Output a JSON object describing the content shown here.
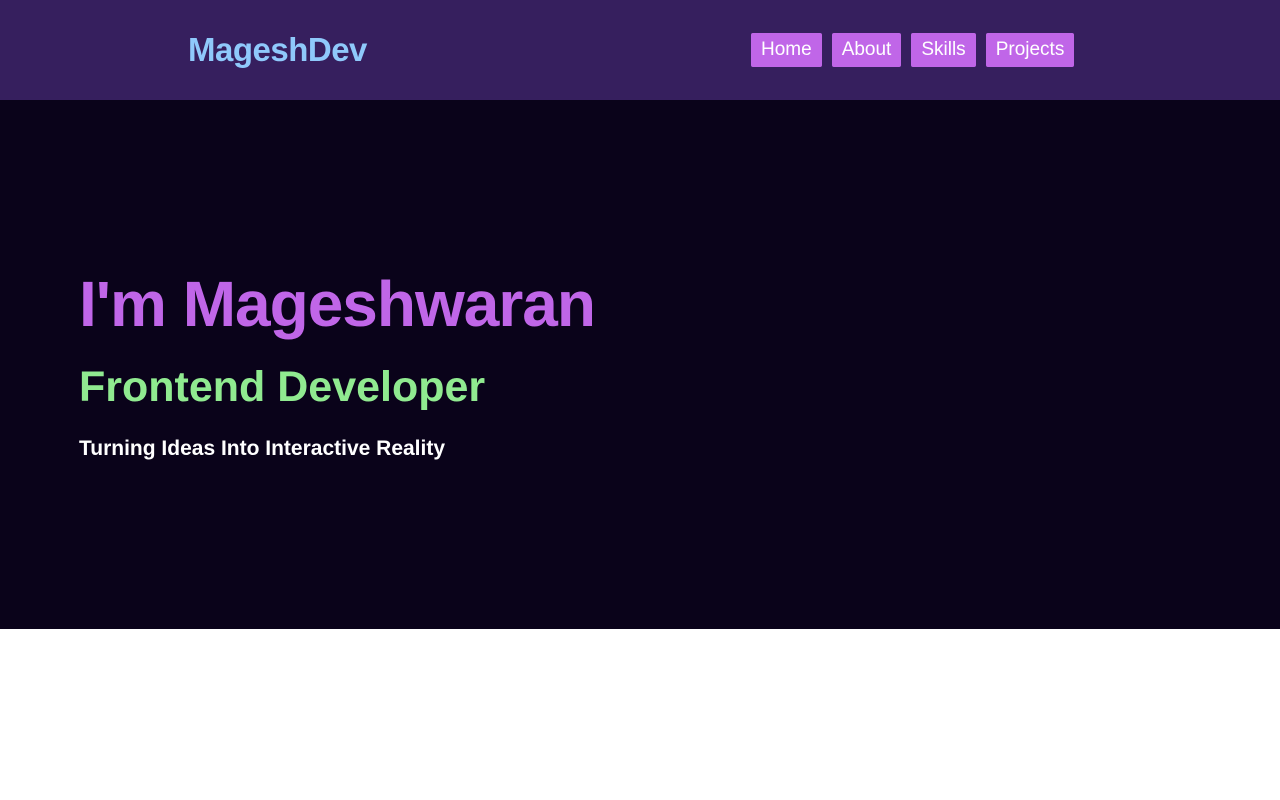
{
  "header": {
    "logo": "MageshDev",
    "nav": [
      {
        "label": "Home"
      },
      {
        "label": "About"
      },
      {
        "label": "Skills"
      },
      {
        "label": "Projects"
      }
    ]
  },
  "hero": {
    "title": "I'm Mageshwaran",
    "role": "Frontend Developer",
    "tagline": "Turning Ideas Into Interactive Reality"
  },
  "colors": {
    "navbar_bg": "#361f5e",
    "logo": "#8fc9fb",
    "nav_button_bg": "#c066e8",
    "hero_bg": "#0a031a",
    "title": "#c066e8",
    "role": "#90ea90",
    "tagline": "#ffffff"
  }
}
